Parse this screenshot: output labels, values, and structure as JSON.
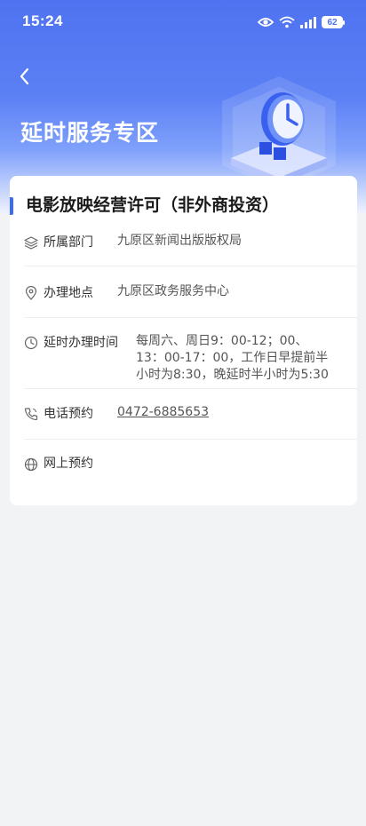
{
  "status_bar": {
    "time": "15:24",
    "battery": "62"
  },
  "header": {
    "title": "延时服务专区"
  },
  "colors": {
    "accent": "#3c6cf2",
    "header_blue": "#4f73f0",
    "link": "#1c2dbf"
  },
  "card": {
    "title": "电影放映经营许可（非外商投资）",
    "rows": [
      {
        "icon": "layers-icon",
        "label": "所属部门",
        "value": "九原区新闻出版版权局"
      },
      {
        "icon": "location-pin-icon",
        "label": "办理地点",
        "value": "九原区政务服务中心"
      },
      {
        "icon": "clock-icon",
        "label": "延时办理时间",
        "value_lines": [
          "每周六、周日9：00-12；00、",
          "13：00-17：00，工作日早提前半",
          "小时为8:30，晚延时半小时为5:30"
        ]
      },
      {
        "icon": "phone-icon",
        "label": "电话预约",
        "value": "0472-6885653"
      },
      {
        "icon": "globe-icon",
        "label": "网上预约",
        "value": ""
      }
    ]
  }
}
